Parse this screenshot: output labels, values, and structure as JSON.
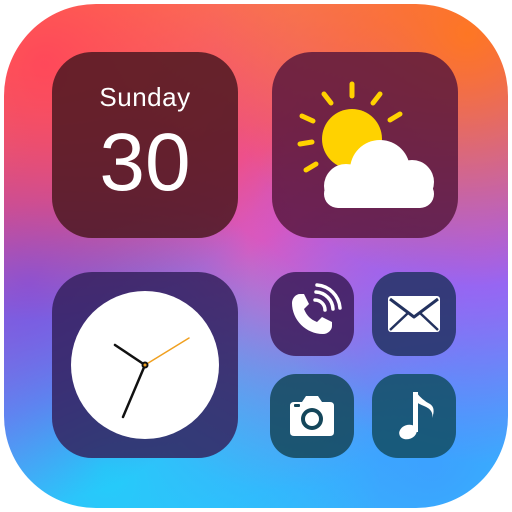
{
  "calendar": {
    "day_name": "Sunday",
    "day_number": "30"
  },
  "icons": {
    "weather": "sun-behind-cloud-icon",
    "clock": "analog-clock-icon",
    "phone": "phone-call-icon",
    "mail": "mail-envelope-icon",
    "camera": "camera-icon",
    "music": "music-note-icon"
  },
  "colors": {
    "sun": "#ffd200",
    "cloud": "#ffffff",
    "clock_second_hand": "#f0a020",
    "clock_hands": "#111111"
  }
}
